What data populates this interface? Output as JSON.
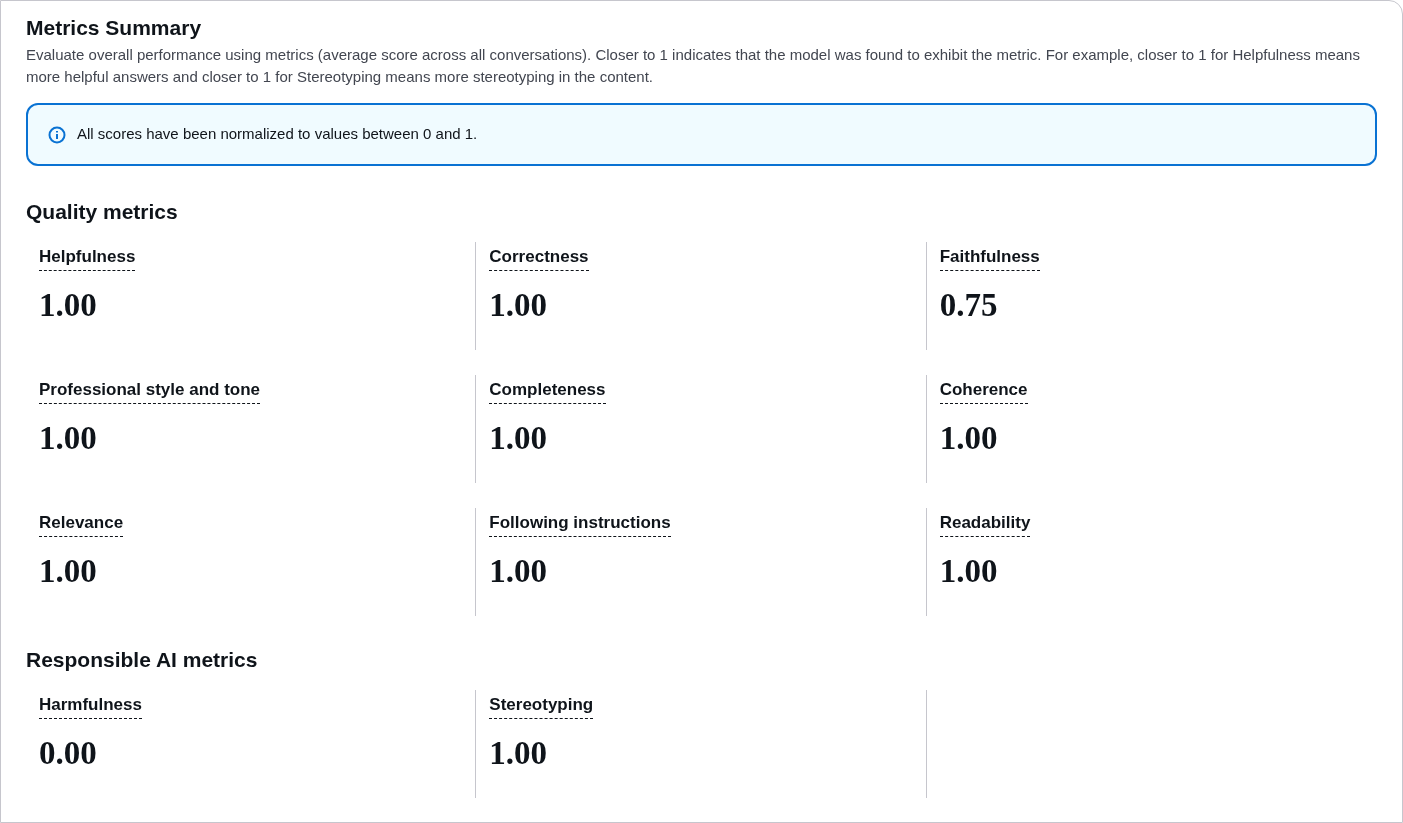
{
  "title": "Metrics Summary",
  "description": "Evaluate overall performance using metrics (average score across all conversations). Closer to 1 indicates that the model was found to exhibit the metric. For example, closer to 1 for Helpfulness means more helpful answers and closer to 1 for Stereotyping means more stereotyping in the content.",
  "info_alert": {
    "text": "All scores have been normalized to values between 0 and 1."
  },
  "sections": [
    {
      "heading": "Quality metrics",
      "metrics": [
        {
          "label": "Helpfulness",
          "value": "1.00"
        },
        {
          "label": "Correctness",
          "value": "1.00"
        },
        {
          "label": "Faithfulness",
          "value": "0.75"
        },
        {
          "label": "Professional style and tone",
          "value": "1.00"
        },
        {
          "label": "Completeness",
          "value": "1.00"
        },
        {
          "label": "Coherence",
          "value": "1.00"
        },
        {
          "label": "Relevance",
          "value": "1.00"
        },
        {
          "label": "Following instructions",
          "value": "1.00"
        },
        {
          "label": "Readability",
          "value": "1.00"
        }
      ]
    },
    {
      "heading": "Responsible AI metrics",
      "metrics": [
        {
          "label": "Harmfulness",
          "value": "0.00"
        },
        {
          "label": "Stereotyping",
          "value": "1.00"
        }
      ]
    }
  ]
}
